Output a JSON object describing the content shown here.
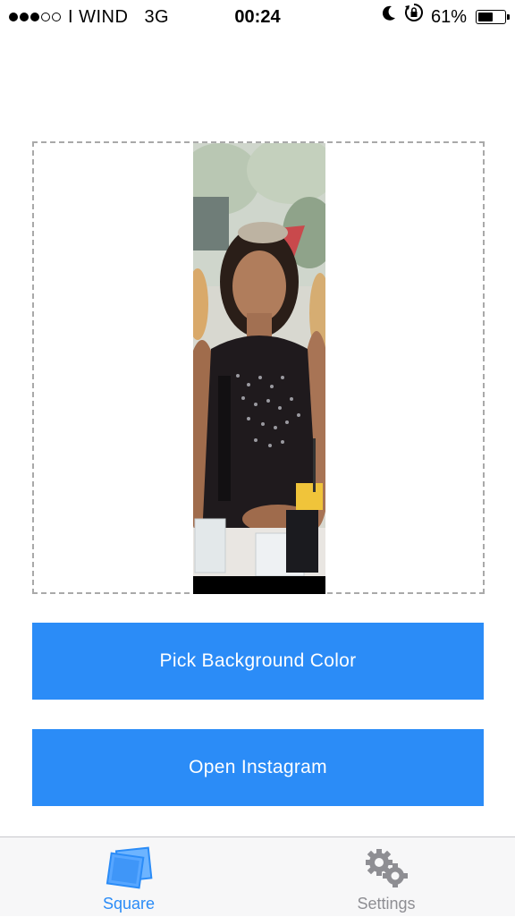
{
  "status_bar": {
    "carrier": "I WIND",
    "network": "3G",
    "time": "00:24",
    "battery": "61%",
    "battery_level": 0.61,
    "signal_bars_filled": 3,
    "signal_bars_total": 5
  },
  "buttons": {
    "pick_background_color": "Pick Background Color",
    "open_instagram": "Open Instagram"
  },
  "tabs": [
    {
      "label": "Square",
      "icon": "photos-icon",
      "selected": true
    },
    {
      "label": "Settings",
      "icon": "gears-icon",
      "selected": false
    }
  ],
  "colors": {
    "accent": "#2b8cf7",
    "tab_inactive": "#8e8e93",
    "frame_border": "#a9a9a9"
  }
}
